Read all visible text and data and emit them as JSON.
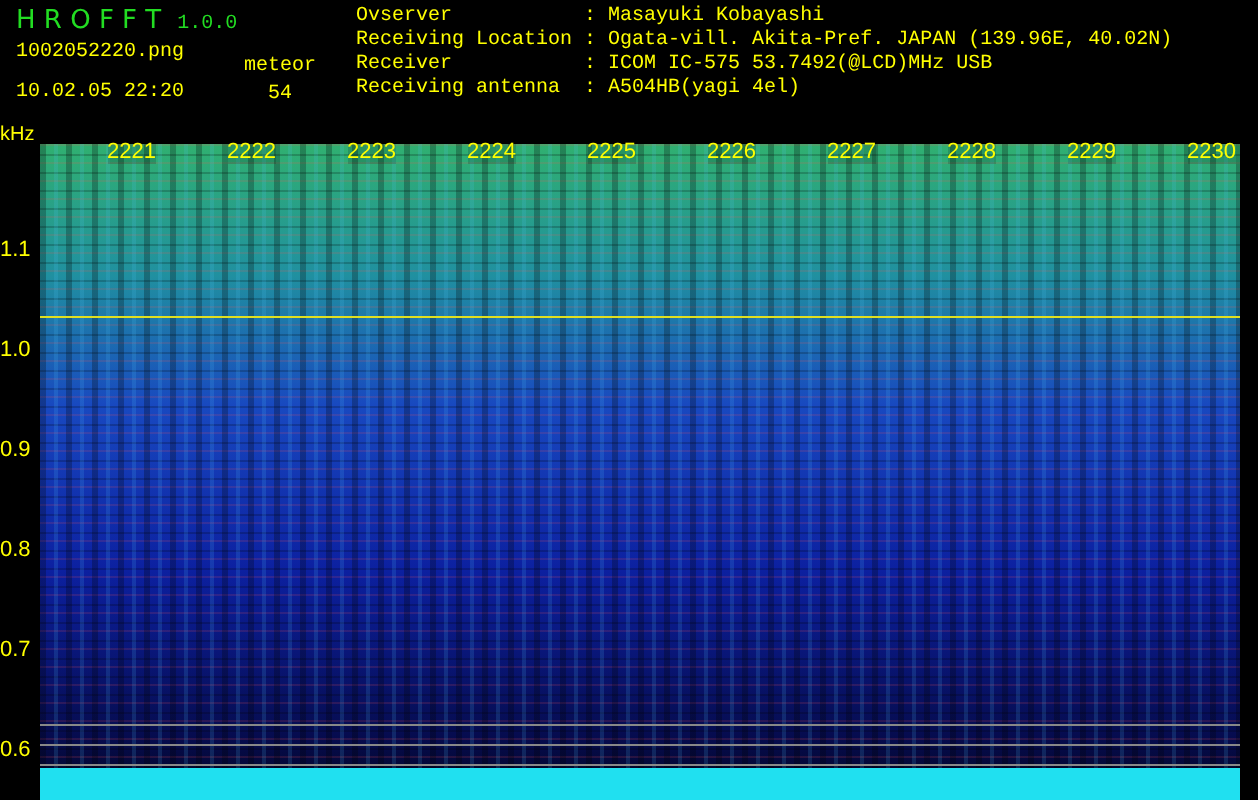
{
  "header": {
    "app_name": "H R O F F T",
    "version": "1.0.0",
    "filename": "1002052220.png",
    "datetime": "10.02.05 22:20",
    "counter_label": "meteor",
    "counter_value": "54"
  },
  "info": [
    {
      "label": "Ovserver",
      "value": "Masayuki Kobayashi"
    },
    {
      "label": "Receiving Location",
      "value": "Ogata-vill. Akita-Pref. JAPAN (139.96E, 40.02N)"
    },
    {
      "label": "Receiver",
      "value": "ICOM IC-575 53.7492(@LCD)MHz USB"
    },
    {
      "label": "Receiving antenna",
      "value": "A504HB(yagi 4el)"
    }
  ],
  "separator": ":",
  "plot": {
    "y_unit": "kHz",
    "y_ticks": [
      "1.1",
      "1.0",
      "0.9",
      "0.8",
      "0.7",
      "0.6"
    ],
    "x_labels": [
      "2221",
      "2222",
      "2223",
      "2224",
      "2225",
      "2226",
      "2227",
      "2228",
      "2229",
      "2230"
    ]
  }
}
